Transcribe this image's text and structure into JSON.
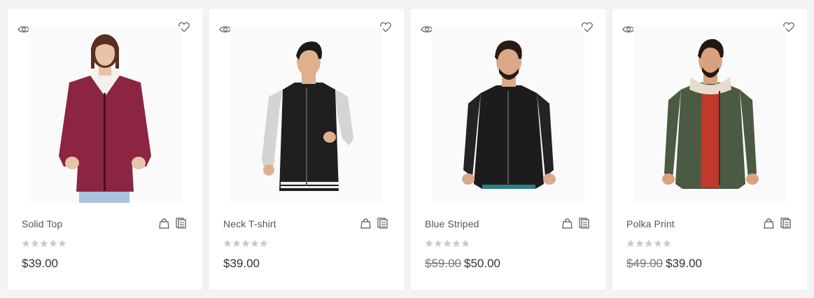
{
  "products": [
    {
      "name": "Solid Top",
      "price": "$39.00",
      "old_price": "",
      "rating": 0,
      "image": "woman-burgundy-zip-hoodie",
      "colors": {
        "garment": "#8b2541",
        "skin": "#e9c3a8",
        "hair": "#5a2f22",
        "pants": "#a9c3de"
      }
    },
    {
      "name": "Neck T-shirt",
      "price": "$39.00",
      "old_price": "",
      "rating": 0,
      "image": "man-black-grey-varsity-jacket",
      "colors": {
        "garment": "#1f1f1f",
        "sleeve": "#d4d4d4",
        "skin": "#e0b08e",
        "hair": "#1a1a1a"
      }
    },
    {
      "name": "Blue Striped",
      "price": "$50.00",
      "old_price": "$59.00",
      "rating": 0,
      "image": "man-black-leather-jacket",
      "colors": {
        "garment": "#1c1c1c",
        "skin": "#d9a98a",
        "hair": "#2a1a12"
      }
    },
    {
      "name": "Polka Print",
      "price": "$39.00",
      "old_price": "$49.00",
      "rating": 0,
      "image": "man-green-fur-collar-jacket",
      "colors": {
        "garment": "#4a5a43",
        "shirt": "#c0392b",
        "collar": "#e6dccb",
        "skin": "#d8a27e",
        "hair": "#241812"
      }
    }
  ],
  "icons": {
    "quick_view": "eye-icon",
    "wishlist": "heart-icon",
    "add_to_cart": "shopping-bag-icon",
    "compare": "compare-icon",
    "rating": "star-icon"
  },
  "theme": {
    "star_color": "#c9c9c9",
    "icon_color": "#555555"
  }
}
